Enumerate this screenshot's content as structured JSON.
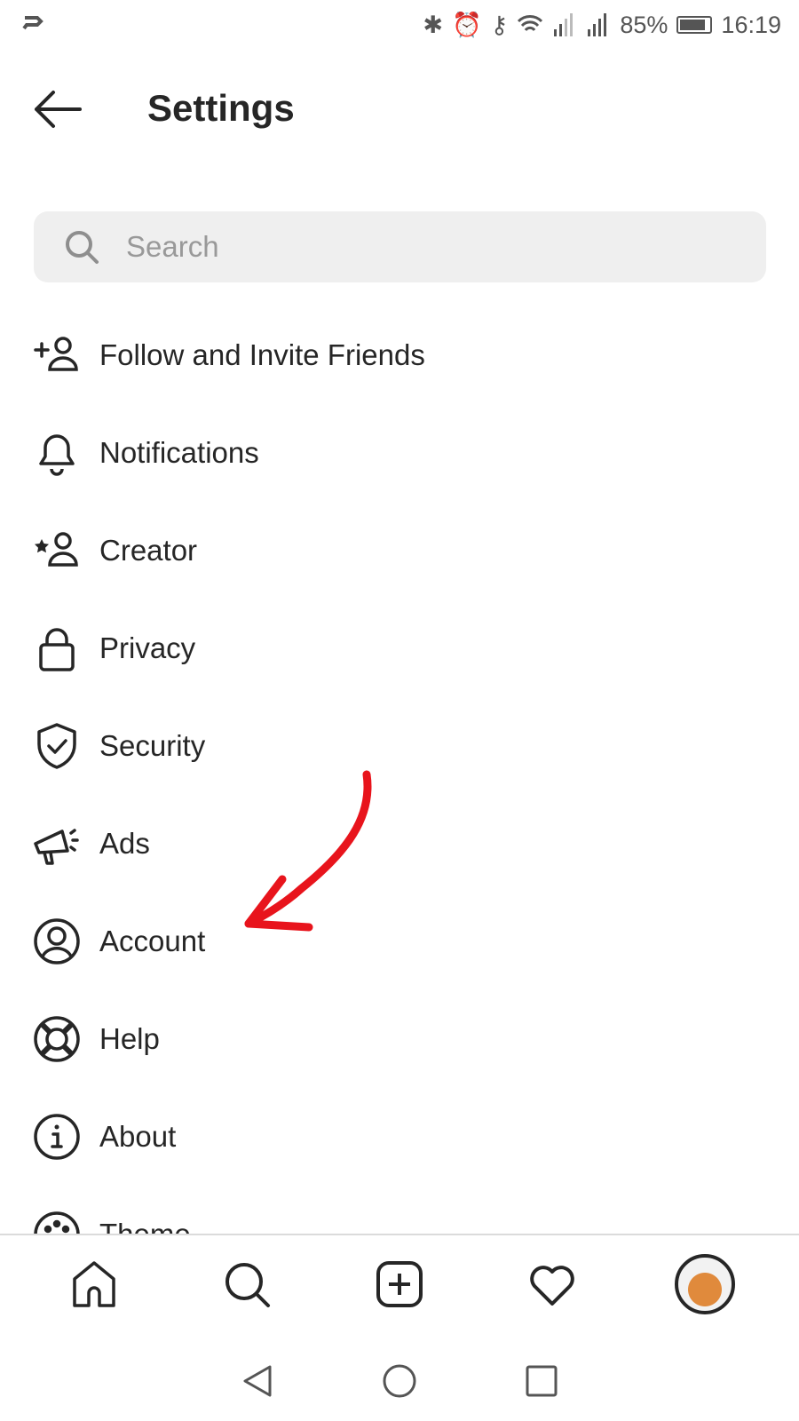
{
  "status_bar": {
    "battery": "85%",
    "battery_level": 0.85,
    "time": "16:19",
    "icons": [
      "bluetooth-icon",
      "alarm-icon",
      "vpn-key-icon",
      "wifi-icon",
      "signal-icon",
      "signal-icon"
    ]
  },
  "header": {
    "title": "Settings"
  },
  "search": {
    "placeholder": "Search"
  },
  "menu": [
    {
      "label": "Follow and Invite Friends",
      "icon": "add-person-icon"
    },
    {
      "label": "Notifications",
      "icon": "bell-icon"
    },
    {
      "label": "Creator",
      "icon": "star-person-icon"
    },
    {
      "label": "Privacy",
      "icon": "lock-icon"
    },
    {
      "label": "Security",
      "icon": "shield-check-icon"
    },
    {
      "label": "Ads",
      "icon": "megaphone-icon"
    },
    {
      "label": "Account",
      "icon": "account-circle-icon"
    },
    {
      "label": "Help",
      "icon": "lifebuoy-icon"
    },
    {
      "label": "About",
      "icon": "info-icon"
    },
    {
      "label": "Theme",
      "icon": "palette-icon"
    }
  ],
  "annotation": {
    "color": "#e8141c",
    "points_to": "Account"
  },
  "tabbar": [
    "home-icon",
    "search-icon",
    "new-post-icon",
    "heart-icon",
    "profile-avatar"
  ]
}
